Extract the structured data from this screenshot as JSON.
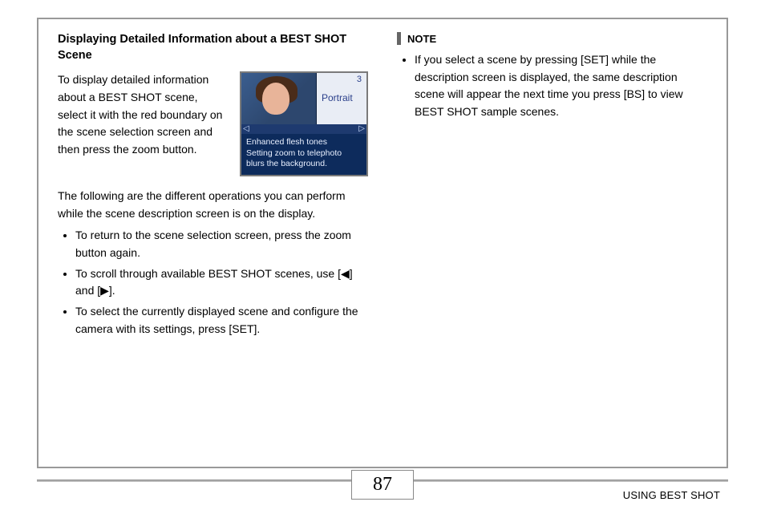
{
  "leftColumn": {
    "title": "Displaying Detailed Information about a BEST SHOT Scene",
    "introText": "To display detailed information about a BEST SHOT scene, select it with the red boundary on the scene selection screen and then press the zoom button.",
    "preview": {
      "number": "3",
      "label": "Portrait",
      "arrowLeft": "◁",
      "arrowRight": "▷",
      "caption": "Enhanced flesh tones\nSetting zoom to telephoto blurs the background."
    },
    "subIntro": "The following are the different operations you can perform while the scene description screen is on the display.",
    "bullets": [
      "To return to the scene selection screen, press the zoom button again.",
      "To scroll through available BEST SHOT scenes, use [◀] and [▶].",
      "To select the currently displayed scene and configure the camera with its settings, press [SET]."
    ]
  },
  "rightColumn": {
    "noteLabel": "NOTE",
    "noteBullets": [
      "If you select a scene by pressing [SET] while the description screen is displayed, the same description scene will appear the next time you press [BS] to view BEST SHOT sample scenes."
    ]
  },
  "footer": {
    "pageNumber": "87",
    "sectionLabel": "USING BEST SHOT"
  }
}
